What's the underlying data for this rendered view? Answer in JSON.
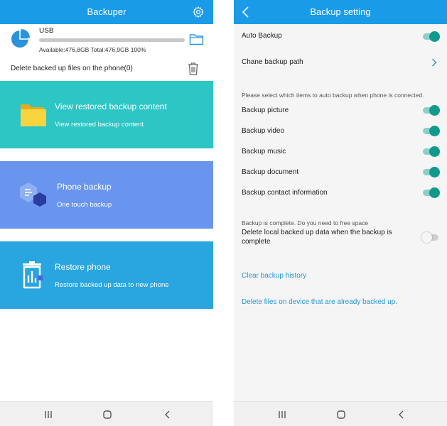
{
  "left": {
    "appbar": {
      "title": "Backuper",
      "settings_icon": "gear-icon"
    },
    "storage": {
      "label": "USB",
      "used_fraction": 1.0,
      "available_text": "Available:476,8GB Total:476,9GB  100%"
    },
    "delete_row": {
      "label": "Delete backed up files on the phone(0)"
    },
    "cards": [
      {
        "title": "View restored backup content",
        "subtitle": "View restored backup content",
        "icon": "folder-icon",
        "color": "#2ec5c5"
      },
      {
        "title": "Phone backup",
        "subtitle": "One touch backup",
        "icon": "backup-icon",
        "color": "#6a95ee"
      },
      {
        "title": "Restore phone",
        "subtitle": "Restore backed up data to new phone",
        "icon": "restore-icon",
        "color": "#29a5df"
      }
    ]
  },
  "right": {
    "appbar": {
      "title": "Backup setting",
      "back_icon": "back-arrow-icon"
    },
    "auto_backup": {
      "label": "Auto Backup",
      "on": true
    },
    "backup_path": {
      "label": "Chane backup path"
    },
    "items_note": "Please select which items to auto backup when phone is connected.",
    "items": [
      {
        "label": "Backup picture",
        "on": true
      },
      {
        "label": "Backup video",
        "on": true
      },
      {
        "label": "Backup music",
        "on": true
      },
      {
        "label": "Backup document",
        "on": true
      },
      {
        "label": "Backup contact information",
        "on": true
      }
    ],
    "free_space_note": "Backup is complete. Do you need to free space",
    "delete_local": {
      "label_line1": "Delete local backed up data when the backup is",
      "label_line2": "complete",
      "on": false
    },
    "clear_history": "Clear backup history",
    "delete_files": "Delete files on device that are already backed up."
  },
  "colors": {
    "appbar": "#1a9be7",
    "toggle_on": "#109a8c",
    "link": "#2497d6"
  },
  "navbar": {
    "icons": [
      "recent-apps-icon",
      "home-icon",
      "back-icon"
    ]
  }
}
